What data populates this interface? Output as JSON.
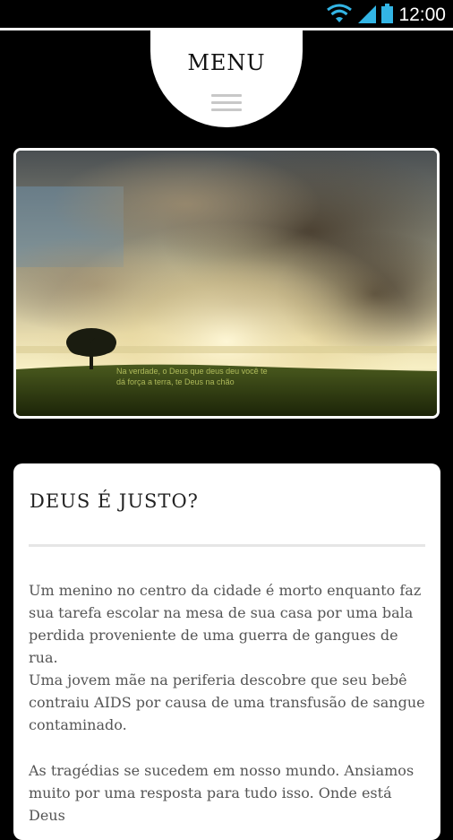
{
  "status_bar": {
    "time": "12:00",
    "icons": [
      "wifi-icon",
      "signal-icon",
      "battery-icon"
    ]
  },
  "menu": {
    "label": "MENU",
    "icon": "hamburger-icon"
  },
  "hero": {
    "caption_line1": "Na verdade, o Deus que deus deu você te",
    "caption_line2": "dá força a terra, te Deus na chão"
  },
  "article": {
    "title": "DEUS É JUSTO?",
    "paragraphs": [
      "Um menino no centro da cidade é morto enquanto faz sua tarefa escolar na mesa de sua casa por uma bala perdida proveniente de uma guerra de gangues de rua.",
      "Uma jovem mãe na periferia descobre que seu bebê contraiu AIDS por causa de uma transfusão de sangue contaminado.",
      "As tragédias se sucedem em nosso mundo. Ansiamos muito por uma resposta para tudo isso. Onde está Deus"
    ]
  },
  "colors": {
    "background": "#000000",
    "card": "#ffffff",
    "body_text": "#555555",
    "title_text": "#222222",
    "status_icons": "#33b5e5"
  }
}
